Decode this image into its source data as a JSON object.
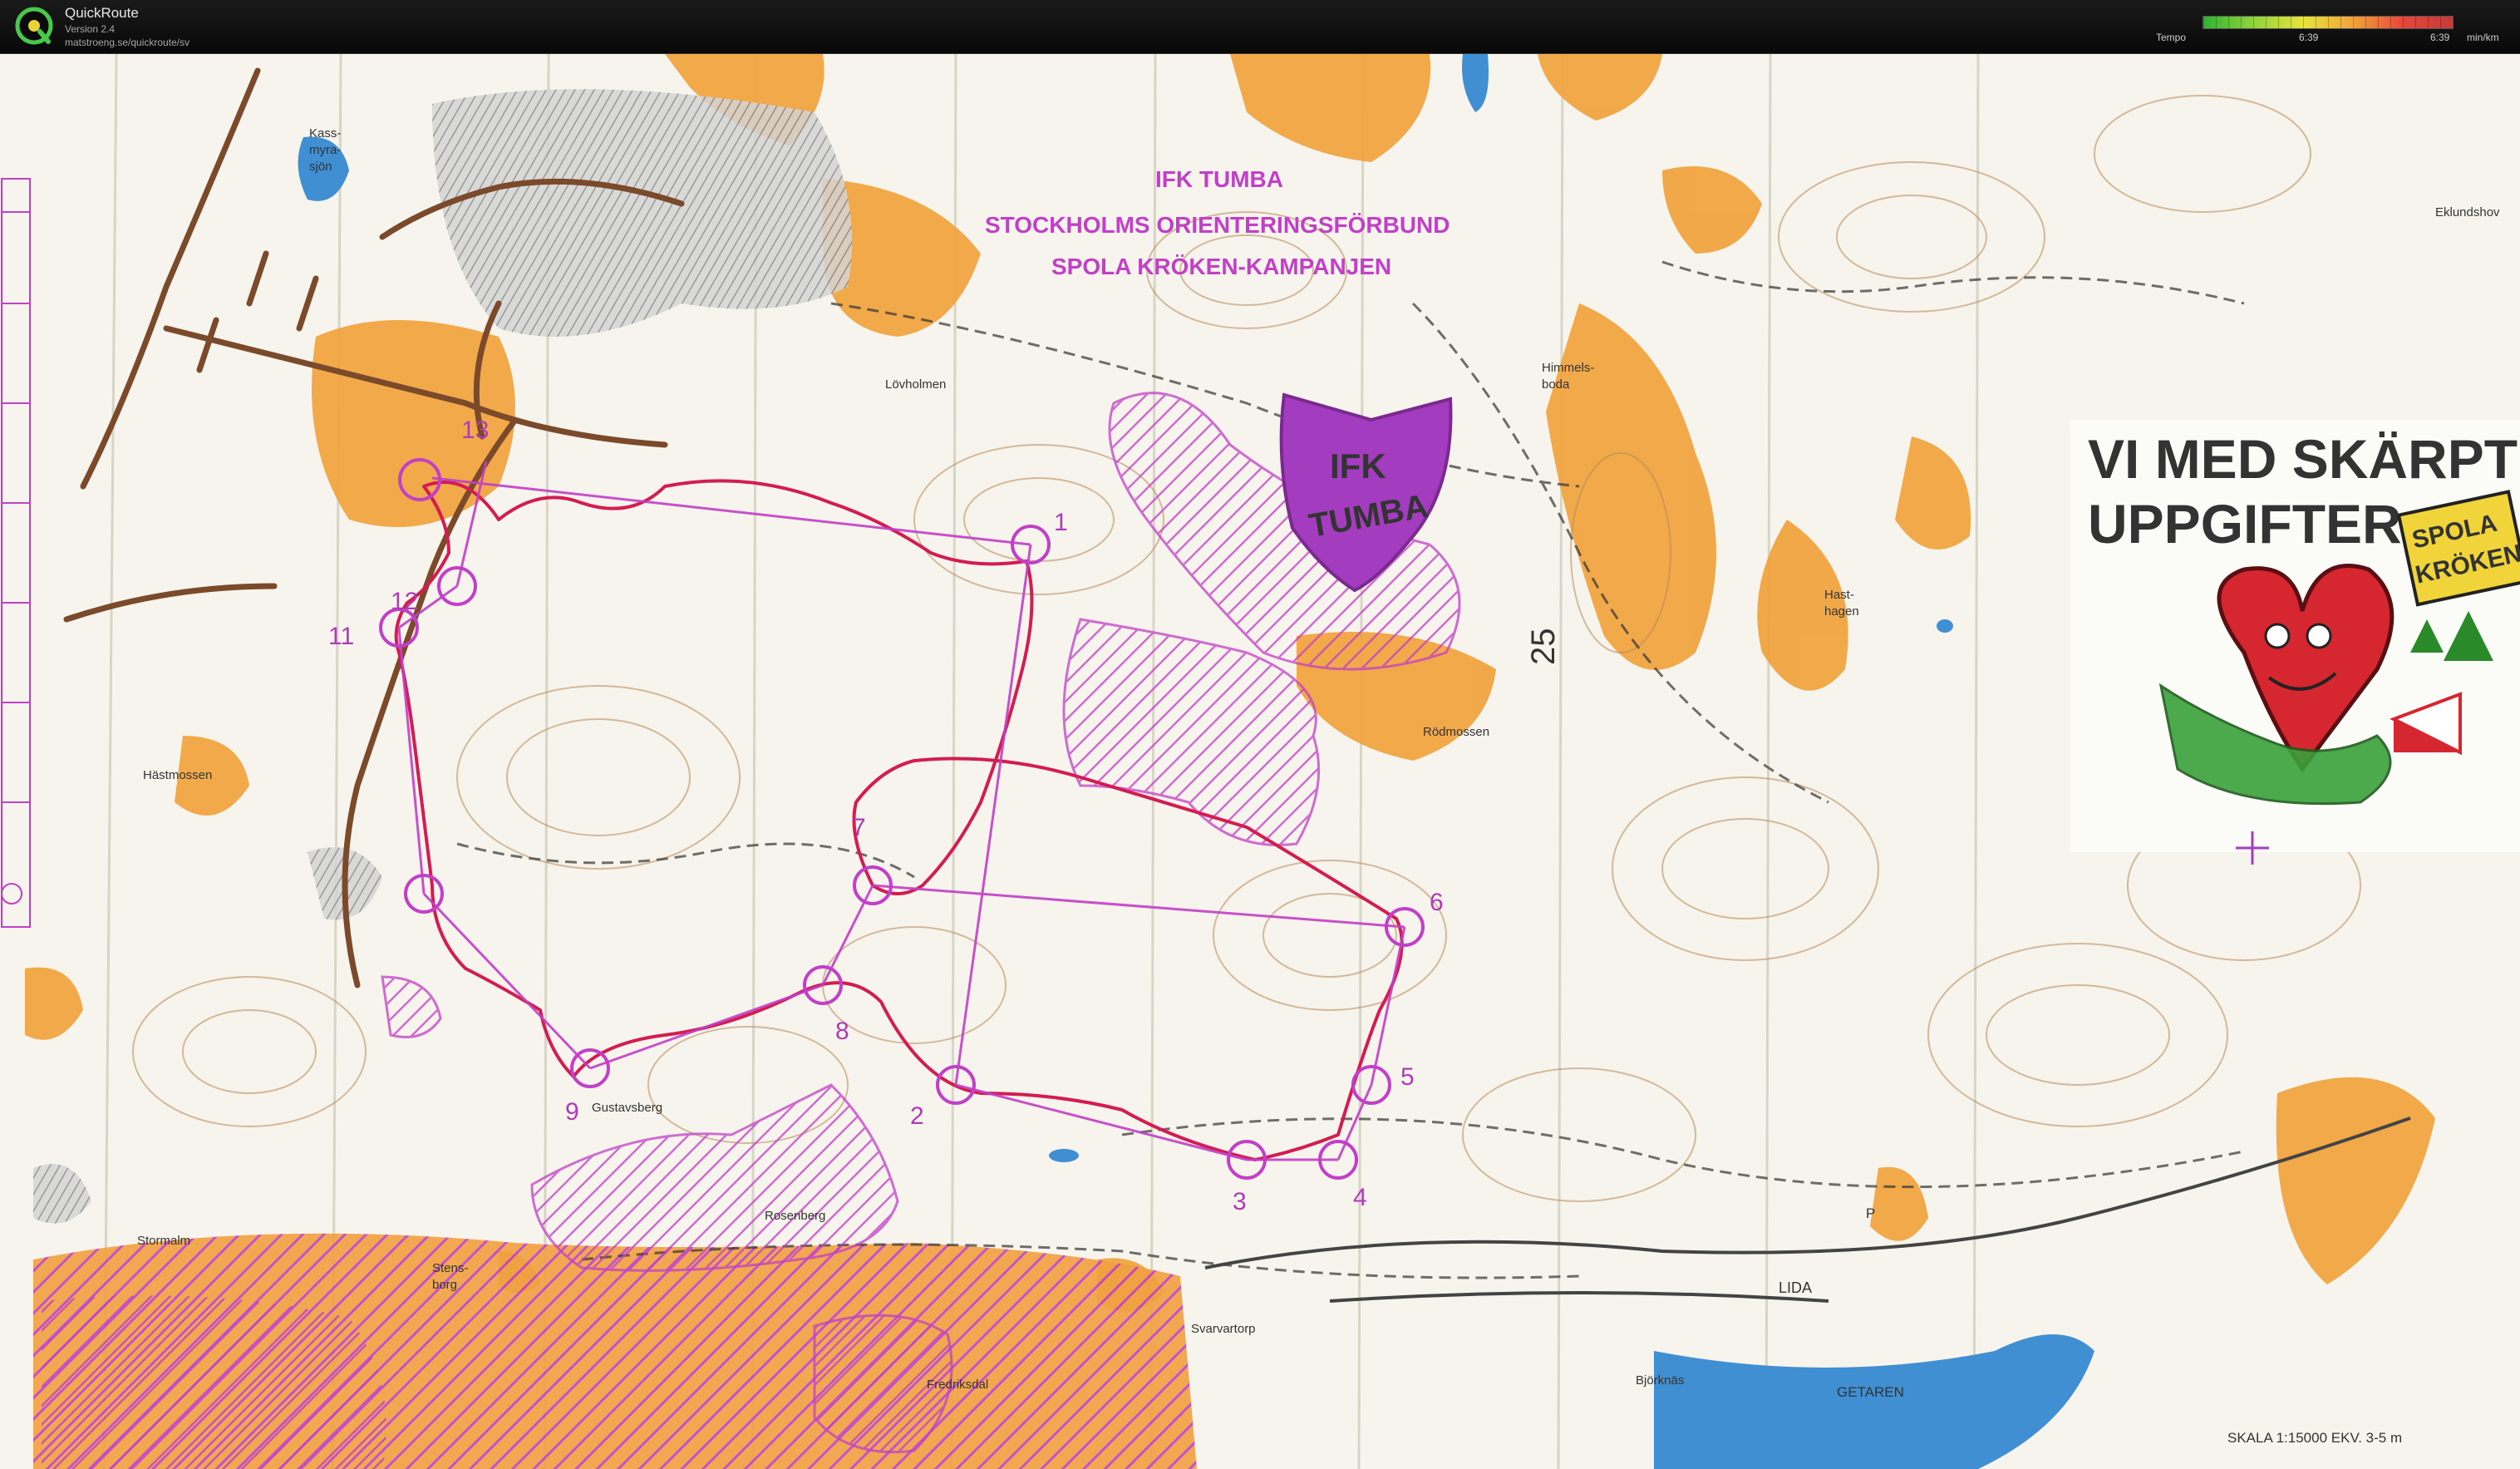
{
  "app": {
    "title": "QuickRoute",
    "version": "Version 2.4",
    "url": "matstroeng.se/quickroute/sv"
  },
  "legend": {
    "label": "Tempo",
    "min_value": "6:39",
    "max_value": "6:39",
    "unit": "min/km"
  },
  "map": {
    "header_lines": [
      "IFK TUMBA",
      "STOCKHOLMS ORIENTERINGSFÖRBUND",
      "SPOLA KRÖKEN-KAMPANJEN"
    ],
    "logo_top": "IFK",
    "logo_bottom": "TUMBA",
    "ad_line1": "VI MED SKÄRPT",
    "ad_line2": "UPPGIFTER",
    "sticker_line1": "SPOLA",
    "sticker_line2": "KRÖKEN",
    "side_number": "25",
    "scale_text": "SKALA 1:15000   EKV. 3-5 m",
    "place_names": [
      "Kass-",
      "myra-",
      "sjön",
      "Lövholmen",
      "Himmels-",
      "boda",
      "Eklundshov",
      "Hast-",
      "hagen",
      "Rödmossen",
      "Hästmossen",
      "Gustavsberg",
      "Rosenberg",
      "Stormalm",
      "Stens-",
      "borg",
      "Fredriksdal",
      "Svarvartorp",
      "Björknäs",
      "LIDA",
      "GETAREN",
      "P"
    ],
    "controls": [
      "1",
      "2",
      "3",
      "4",
      "5",
      "6",
      "7",
      "8",
      "9",
      "11",
      "12",
      "13"
    ],
    "colors": {
      "paper": "#f6f4ec",
      "open_land": "#f1a23c",
      "course": "#c23fc7",
      "route": "#d21c52",
      "water": "#3f8fd2",
      "road": "#7a4a2a",
      "contour": "#b88858"
    }
  }
}
